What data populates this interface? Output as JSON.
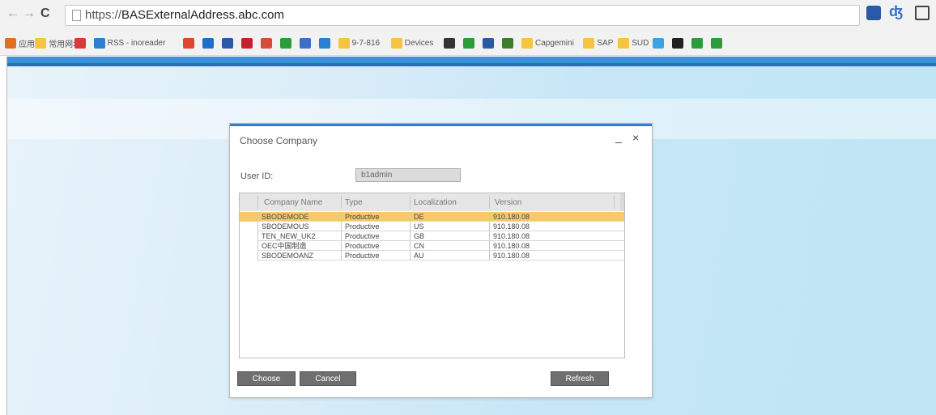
{
  "browser": {
    "url_prefix": "https://",
    "url_host": "BASExternalAddress.abc.com",
    "bookmarks": [
      {
        "label": "应用",
        "icon": "apps-icon",
        "color": "#e07020"
      },
      {
        "label": "常用网址",
        "icon": "folder-icon",
        "color": "#f5c542"
      },
      {
        "label": "",
        "icon": "bookmark-icon",
        "color": "#d83a3a"
      },
      {
        "label": "RSS - inoreader",
        "icon": "rss-icon",
        "color": "#2f7fd0"
      },
      {
        "label": "",
        "icon": "chrome-icon",
        "color": "#e0452f"
      },
      {
        "label": "",
        "icon": "outlook-icon",
        "color": "#1e6fc7"
      },
      {
        "label": "",
        "icon": "home-icon",
        "color": "#2a5aa6"
      },
      {
        "label": "",
        "icon": "flag-icon",
        "color": "#c8202a"
      },
      {
        "label": "",
        "icon": "gmail-icon",
        "color": "#d64b3c"
      },
      {
        "label": "",
        "icon": "windows-icon",
        "color": "#2c9b3b"
      },
      {
        "label": "",
        "icon": "app-icon",
        "color": "#3b6fc9"
      },
      {
        "label": "",
        "icon": "picture-icon",
        "color": "#2a7fd0"
      },
      {
        "label": "9-7-816",
        "icon": "folder-icon",
        "color": "#f5c542"
      },
      {
        "label": "Devices",
        "icon": "folder-icon",
        "color": "#f5c542"
      },
      {
        "label": "",
        "icon": "pin-icon",
        "color": "#333333"
      },
      {
        "label": "",
        "icon": "diamond-icon",
        "color": "#2c9b3b"
      },
      {
        "label": "",
        "icon": "doc-icon",
        "color": "#2a5aa6"
      },
      {
        "label": "",
        "icon": "sheet-icon",
        "color": "#3a7d2e"
      },
      {
        "label": "Capgemini",
        "icon": "folder-icon",
        "color": "#f5c542"
      },
      {
        "label": "SAP",
        "icon": "folder-icon",
        "color": "#f5c542"
      },
      {
        "label": "SUD",
        "icon": "folder-icon",
        "color": "#f5c542"
      },
      {
        "label": "",
        "icon": "drive-icon",
        "color": "#3aa5e0"
      },
      {
        "label": "",
        "icon": "github-icon",
        "color": "#222222"
      },
      {
        "label": "",
        "icon": "c-icon",
        "color": "#2c9b3b"
      },
      {
        "label": "",
        "icon": "diamond-icon",
        "color": "#2c9b3b"
      }
    ]
  },
  "dialog": {
    "title": "Choose Company",
    "minimize_glyph": "_",
    "close_glyph": "×",
    "user_id_label": "User ID:",
    "user_id_value": "b1admin",
    "columns": [
      "Company Name",
      "Type",
      "Localization",
      "Version"
    ],
    "rows": [
      {
        "name": "SBODEMODE",
        "type": "Productive",
        "localization": "DE",
        "version": "910.180.08",
        "selected": true
      },
      {
        "name": "SBODEMOUS",
        "type": "Productive",
        "localization": "US",
        "version": "910.180.08",
        "selected": false
      },
      {
        "name": "TEN_NEW_UK2",
        "type": "Productive",
        "localization": "GB",
        "version": "910.180.08",
        "selected": false
      },
      {
        "name": "OEC中国制造",
        "type": "Productive",
        "localization": "CN",
        "version": "910.180.08",
        "selected": false
      },
      {
        "name": "SBODEMOANZ",
        "type": "Productive",
        "localization": "AU",
        "version": "910.180.08",
        "selected": false
      }
    ],
    "buttons": {
      "choose": "Choose",
      "cancel": "Cancel",
      "refresh": "Refresh"
    }
  }
}
